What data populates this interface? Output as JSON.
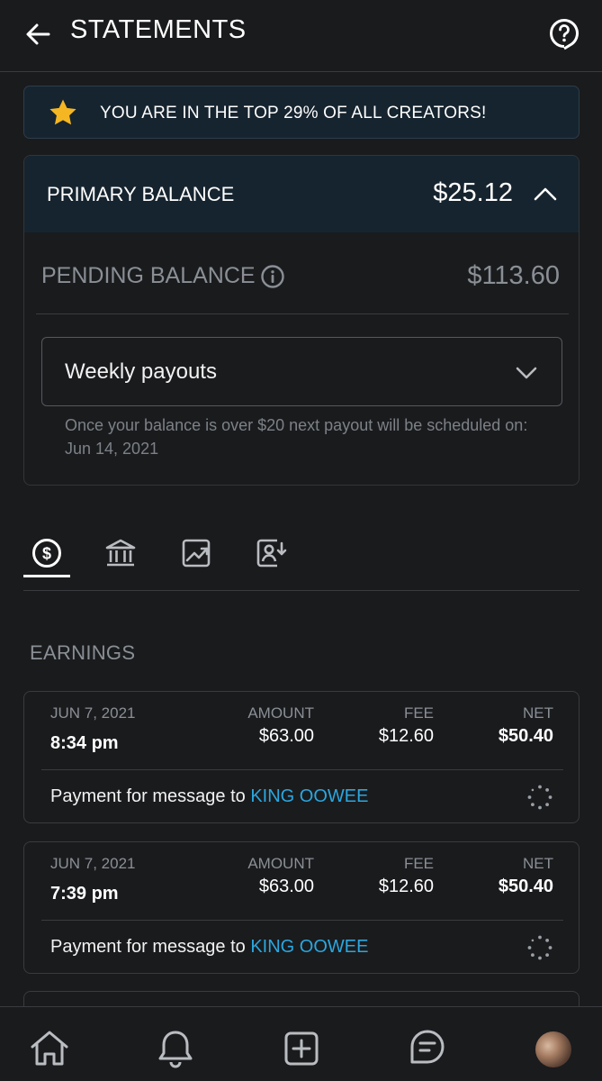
{
  "header": {
    "title": "STATEMENTS"
  },
  "banner": {
    "text": "YOU ARE IN THE TOP 29% OF ALL CREATORS!",
    "star_color": "#f5b623"
  },
  "balances": {
    "primary_label": "PRIMARY BALANCE",
    "primary_amount": "$25.12",
    "pending_label": "PENDING BALANCE",
    "pending_amount": "$113.60"
  },
  "payout": {
    "selected": "Weekly payouts",
    "note": "Once your balance is over $20 next payout will be scheduled on: Jun 14, 2021"
  },
  "tabs": [
    {
      "icon": "dollar-circle-icon",
      "active": true
    },
    {
      "icon": "bank-icon",
      "active": false
    },
    {
      "icon": "chart-icon",
      "active": false
    },
    {
      "icon": "referral-icon",
      "active": false
    }
  ],
  "earnings": {
    "title": "EARNINGS",
    "labels": {
      "amount": "AMOUNT",
      "fee": "FEE",
      "net": "NET"
    },
    "items": [
      {
        "date": "JUN 7, 2021",
        "time": "8:34 pm",
        "amount": "$63.00",
        "fee": "$12.60",
        "net": "$50.40",
        "desc_prefix": "Payment for message to",
        "desc_link": "KING OOWEE"
      },
      {
        "date": "JUN 7, 2021",
        "time": "7:39 pm",
        "amount": "$63.00",
        "fee": "$12.60",
        "net": "$50.40",
        "desc_prefix": "Payment for message to",
        "desc_link": "KING OOWEE"
      }
    ]
  },
  "colors": {
    "background": "#1a1b1d",
    "banner_bg": "#16242f",
    "link": "#2aa7e0",
    "muted": "#8a8f96"
  },
  "nav": [
    "home-icon",
    "bell-icon",
    "add-icon",
    "message-icon",
    "avatar"
  ]
}
